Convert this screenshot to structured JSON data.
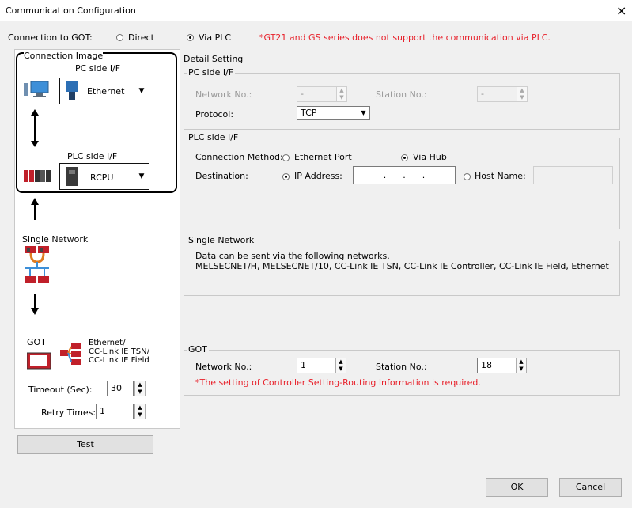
{
  "window": {
    "title": "Communication Configuration",
    "close_glyph": "×"
  },
  "connection": {
    "label": "Connection to GOT:",
    "direct": "Direct",
    "via_plc": "Via PLC",
    "selected": "Via PLC",
    "note": "*GT21 and GS series does not support the communication via PLC."
  },
  "image": {
    "group_label": "Connection Image",
    "pc_if_label": "PC side I/F",
    "pc_if_value": "Ethernet",
    "plc_if_label": "PLC side I/F",
    "plc_if_value": "RCPU",
    "single_network": "Single Network",
    "got": "GOT",
    "got_network": "Ethernet/\nCC-Link IE TSN/\nCC-Link IE Field",
    "timeout_label": "Timeout (Sec):",
    "timeout_value": "30",
    "retry_label": "Retry Times:",
    "retry_value": "1",
    "test_button": "Test"
  },
  "detail": {
    "group_label": "Detail Setting",
    "pc_if": {
      "group_label": "PC side I/F",
      "network_no_label": "Network No.:",
      "network_no_value": "-",
      "station_no_label": "Station No.:",
      "station_no_value": "-",
      "protocol_label": "Protocol:",
      "protocol_value": "TCP"
    },
    "plc_if": {
      "group_label": "PLC side I/F",
      "method_label": "Connection Method:",
      "ethernet_port": "Ethernet Port",
      "via_hub": "Via Hub",
      "method_selected": "Via Hub",
      "destination_label": "Destination:",
      "ip_label": "IP Address:",
      "ip_value": ".      .      .",
      "host_label": "Host Name:",
      "host_value": "",
      "destination_selected": "IP Address:"
    }
  },
  "single_network": {
    "group_label": "Single Network",
    "line1": "Data can be sent via the following networks.",
    "line2": "MELSECNET/H, MELSECNET/10, CC-Link IE TSN, CC-Link IE Controller, CC-Link IE Field, Ethernet"
  },
  "got": {
    "group_label": "GOT",
    "network_no_label": "Network No.:",
    "network_no_value": "1",
    "station_no_label": "Station No.:",
    "station_no_value": "18",
    "note": "*The setting of Controller Setting-Routing Information is required."
  },
  "footer": {
    "ok": "OK",
    "cancel": "Cancel"
  },
  "colors": {
    "note_red": "#e8202a",
    "background": "#f0f0f0"
  }
}
